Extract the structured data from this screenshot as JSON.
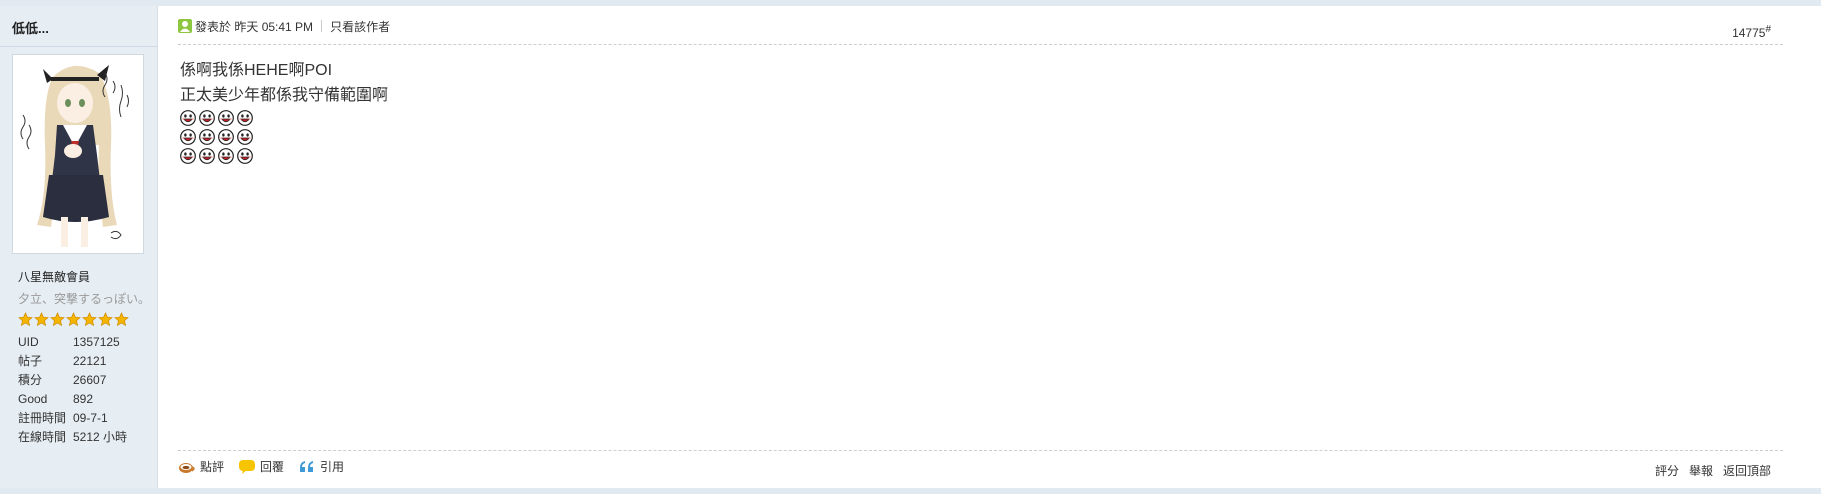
{
  "user": {
    "name": "低低...",
    "group": "八星無敵會員",
    "custom_title": "夕立、突撃するっぽい。",
    "star_count": 7,
    "stats": [
      {
        "label": "UID",
        "value": "1357125"
      },
      {
        "label": "帖子",
        "value": "22121"
      },
      {
        "label": "積分",
        "value": "26607"
      },
      {
        "label": "Good",
        "value": "892"
      },
      {
        "label": "註冊時間",
        "value": "09-7-1"
      },
      {
        "label": "在線時間",
        "value": "5212 小時"
      }
    ]
  },
  "post": {
    "posted_prefix": "發表於",
    "posted_time": "昨天 05:41 PM",
    "only_author": "只看該作者",
    "floor": "14775",
    "floor_mark": "#",
    "lines": [
      "係啊我係HEHE啊POI",
      "正太美少年都係我守備範圍啊"
    ],
    "emote_rows": 3,
    "emotes_per_row": 4,
    "emote_icon": "smiley-face-icon"
  },
  "actions": {
    "comment": "點評",
    "reply": "回覆",
    "quote": "引用",
    "rate": "評分",
    "report": "舉報",
    "back_top": "返回頂部"
  },
  "colors": {
    "sidebar_bg": "#e6edf3",
    "star": "#f5b400",
    "online_icon": "#8dc63f",
    "reply_icon": "#f7c400",
    "quote_icon": "#3d9ad6"
  }
}
